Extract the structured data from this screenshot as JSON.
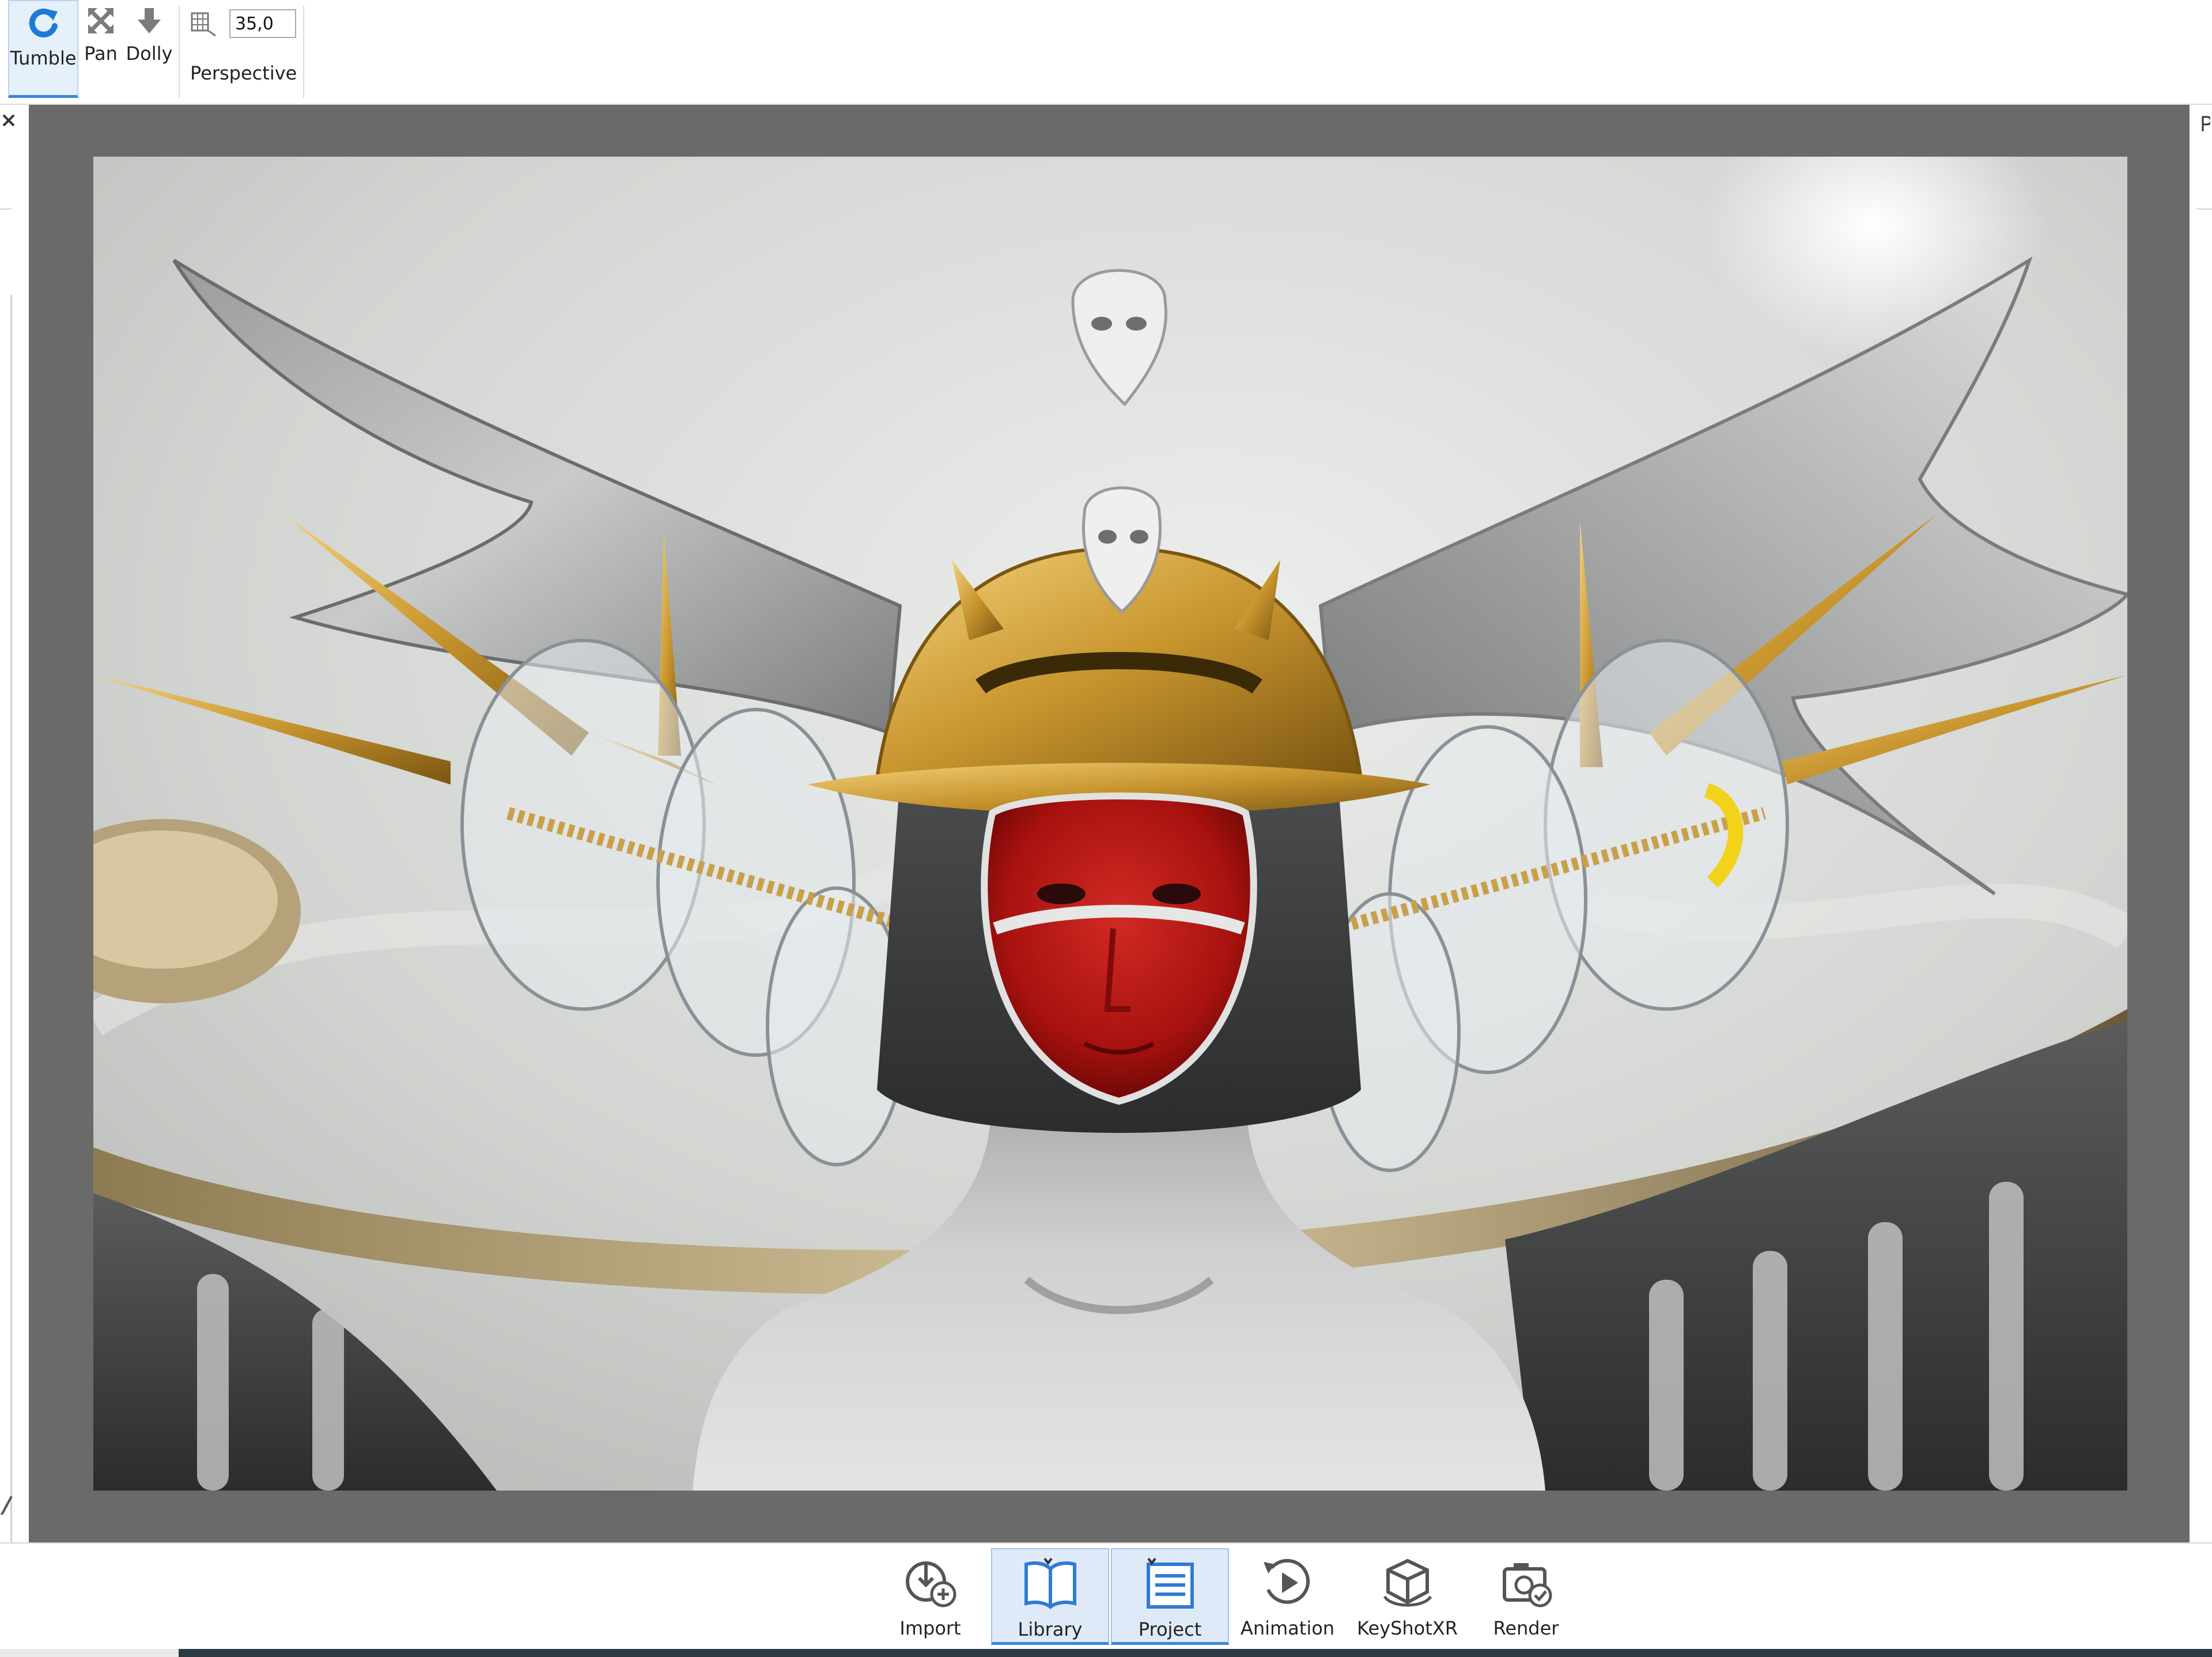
{
  "toolbar": {
    "tumble_label": "Tumble",
    "pan_label": "Pan",
    "dolly_label": "Dolly",
    "fov_value": "35,0",
    "perspective_label": "Perspective"
  },
  "ribbon": {
    "items": [
      {
        "label": "Import",
        "icon": "import-icon"
      },
      {
        "label": "Library",
        "icon": "library-book-icon"
      },
      {
        "label": "Project",
        "icon": "project-list-icon"
      },
      {
        "label": "Animation",
        "icon": "animation-play-icon"
      },
      {
        "label": "KeyShotXR",
        "icon": "keyshotxr-cube-icon"
      },
      {
        "label": "Render",
        "icon": "render-camera-icon"
      }
    ]
  },
  "colors": {
    "accent": "#3a86d9",
    "viewport_bg": "#6a6a6a",
    "active_bg": "#dfeaf8"
  }
}
